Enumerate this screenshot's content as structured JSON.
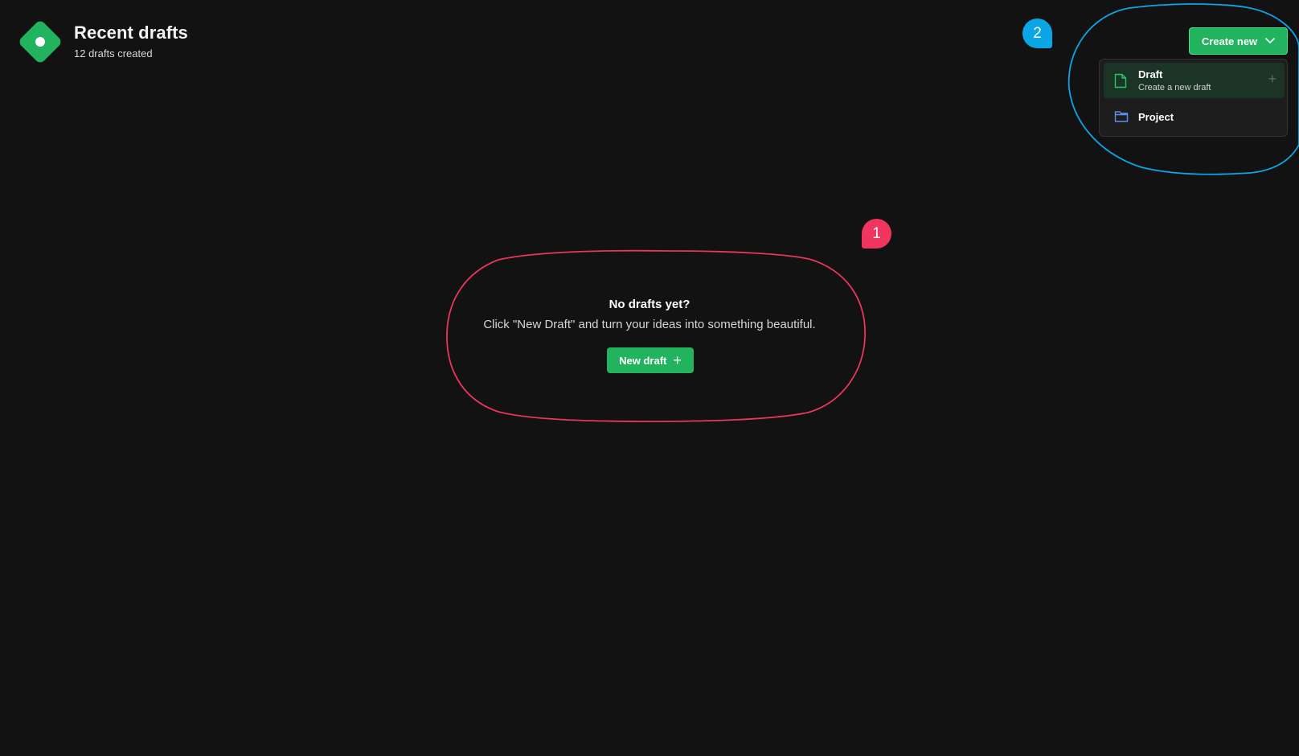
{
  "header": {
    "title": "Recent drafts",
    "subtitle": "12 drafts created",
    "logo_icon": "diamond-logo-icon"
  },
  "empty_state": {
    "heading": "No drafts yet?",
    "description": "Click \"New Draft\" and turn your ideas into something beautiful.",
    "button_label": "New draft",
    "button_icon": "plus-icon"
  },
  "create_menu": {
    "button_label": "Create new",
    "button_icon": "chevron-down-icon",
    "items": [
      {
        "label": "Draft",
        "description": "Create a new draft",
        "icon": "file-icon",
        "active": true
      },
      {
        "label": "Project",
        "icon": "folder-icon",
        "active": false
      }
    ]
  },
  "annotations": [
    {
      "number": "1",
      "color": "#f0365f"
    },
    {
      "number": "2",
      "color": "#0aa6e5"
    }
  ],
  "colors": {
    "background": "#121212",
    "accent": "#22b35e",
    "menu_background": "#1d1d1d",
    "menu_active": "#1c3426",
    "file_icon": "#22c968",
    "folder_icon": "#5b8ff0"
  }
}
